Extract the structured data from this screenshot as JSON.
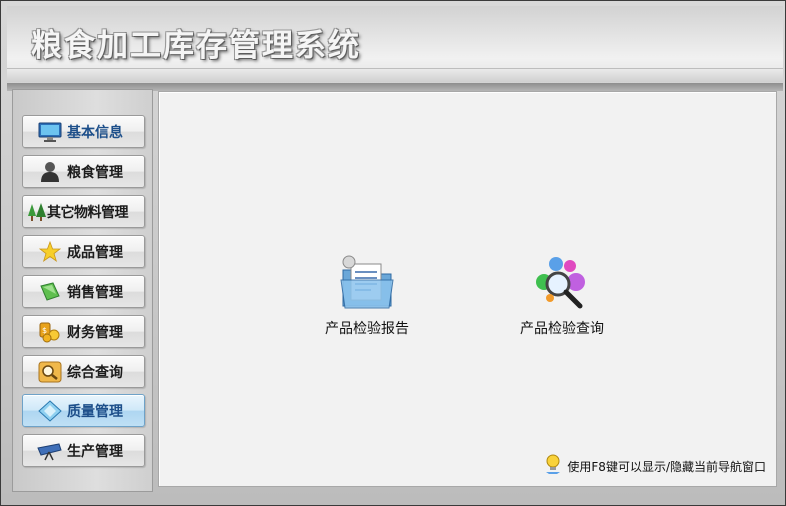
{
  "header": {
    "title": "粮食加工库存管理系统"
  },
  "sidebar": {
    "items": [
      {
        "label": "基本信息",
        "icon": "monitor-icon"
      },
      {
        "label": "粮食管理",
        "icon": "person-icon"
      },
      {
        "label": "其它物料管理",
        "icon": "trees-icon"
      },
      {
        "label": "成品管理",
        "icon": "star-icon"
      },
      {
        "label": "销售管理",
        "icon": "book-icon"
      },
      {
        "label": "财务管理",
        "icon": "coins-icon"
      },
      {
        "label": "综合查询",
        "icon": "magnifier-icon"
      },
      {
        "label": "质量管理",
        "icon": "diamond-icon"
      },
      {
        "label": "生产管理",
        "icon": "telescope-icon"
      }
    ],
    "active_index": 7
  },
  "main": {
    "tiles": [
      {
        "label": "产品检验报告",
        "icon": "report-folder-icon"
      },
      {
        "label": "产品检验查询",
        "icon": "search-spheres-icon"
      }
    ],
    "hint": "使用F8键可以显示/隐藏当前导航窗口"
  },
  "colors": {
    "active_nav": "#aed6f1",
    "content_bg": "#f2f2f2",
    "accent_blue": "#1d4f8a"
  }
}
